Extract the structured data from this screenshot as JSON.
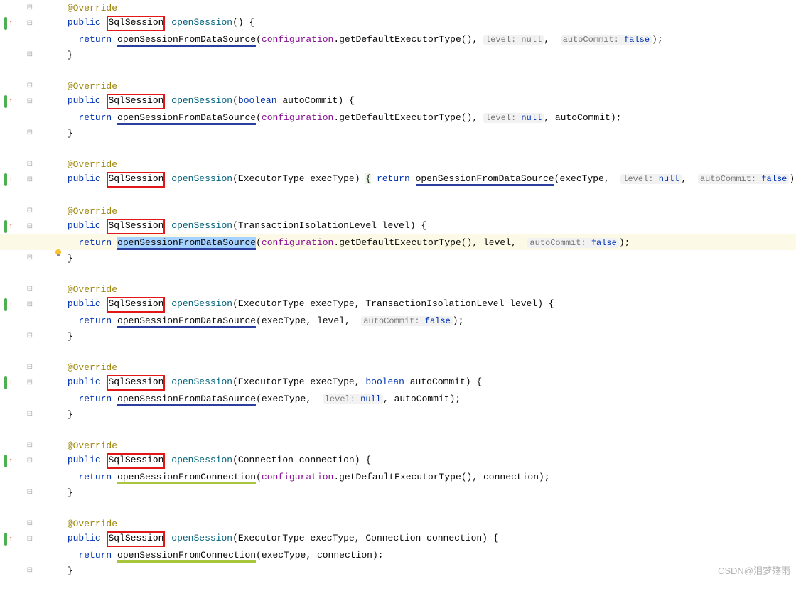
{
  "annotation": "@Override",
  "visibility": "public",
  "typeName": "SqlSession",
  "methodName": "openSession",
  "returnKw": "return",
  "dsCall": "openSessionFromDataSource",
  "connCall": "openSessionFromConnection",
  "configRef": "configuration",
  "defaultExec": ".getDefaultExecutorType()",
  "hints": {
    "levelNull": "level: null",
    "autoCommitFalse": "autoCommit: false",
    "autoCommit": "autoCommit:"
  },
  "falseLit": "false",
  "nullLit": "null",
  "p": {
    "boolAutoCommit": "boolean autoCommit",
    "execType": "ExecutorType execType",
    "txLevel": "TransactionIsolationLevel level",
    "conn": "Connection connection"
  },
  "args": {
    "execType": "execType",
    "level": "level",
    "autoCommit": "autoCommit",
    "connection": "connection"
  },
  "watermark": "CSDN@泪梦殇雨"
}
